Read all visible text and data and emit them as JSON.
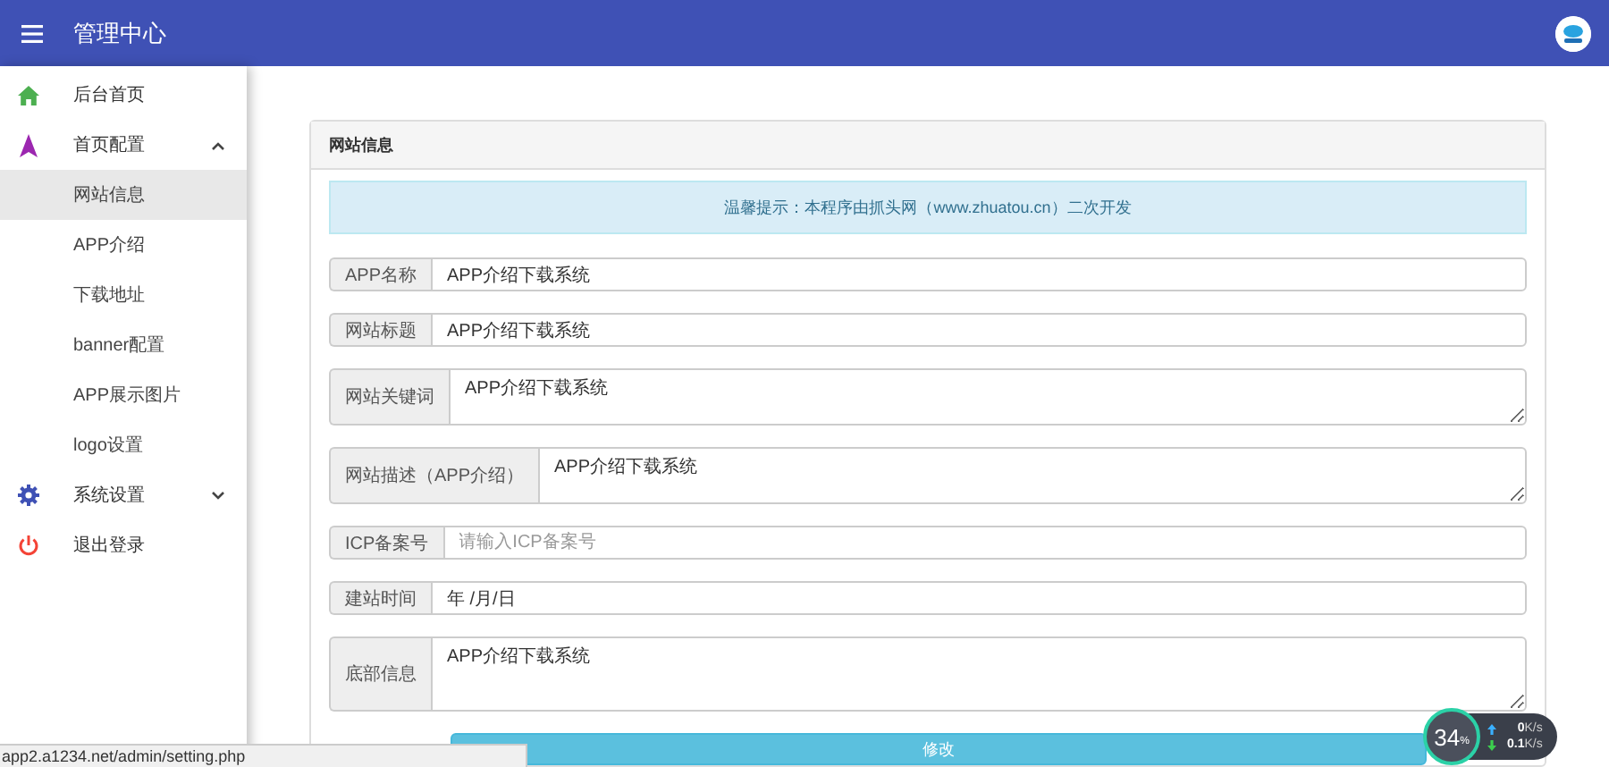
{
  "header": {
    "title": "管理中心"
  },
  "sidebar": {
    "items": [
      {
        "label": "后台首页",
        "selected": false
      },
      {
        "label": "首页配置",
        "selected": false,
        "expanded": true,
        "children": [
          {
            "label": "网站信息",
            "selected": true
          },
          {
            "label": "APP介绍",
            "selected": false
          },
          {
            "label": "下载地址",
            "selected": false
          },
          {
            "label": "banner配置",
            "selected": false
          },
          {
            "label": "APP展示图片",
            "selected": false
          },
          {
            "label": "logo设置",
            "selected": false
          }
        ]
      },
      {
        "label": "系统设置",
        "selected": false,
        "expanded": false
      },
      {
        "label": "退出登录",
        "selected": false
      }
    ]
  },
  "panel": {
    "title": "网站信息",
    "notice": "温馨提示：本程序由抓头网（www.zhuatou.cn）二次开发",
    "fields": [
      {
        "label": "APP名称",
        "kind": "text",
        "value": "APP介绍下载系统"
      },
      {
        "label": "网站标题",
        "kind": "text",
        "value": "APP介绍下载系统"
      },
      {
        "label": "网站关键词",
        "kind": "textarea",
        "value": "APP介绍下载系统"
      },
      {
        "label": "网站描述（APP介绍）",
        "kind": "textarea",
        "value": "APP介绍下载系统"
      },
      {
        "label": "ICP备案号",
        "kind": "text",
        "placeholder": "请输入ICP备案号"
      },
      {
        "label": "建站时间",
        "kind": "date",
        "value": "年 /月/日"
      },
      {
        "label": "底部信息",
        "kind": "tallarea",
        "value": "APP介绍下载系统"
      }
    ],
    "submit": "修改"
  },
  "status_url": "app2.a1234.net/admin/setting.php",
  "speed_widget": {
    "percent": "34",
    "percent_sign": "%",
    "upload": "0",
    "upload_unit": "K/s",
    "download": "0.1",
    "download_unit": "K/s"
  }
}
